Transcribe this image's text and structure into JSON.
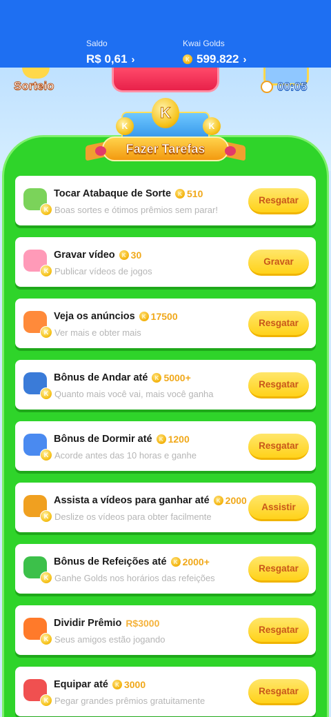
{
  "header": {
    "saldo_label": "Saldo",
    "saldo_value": "R$ 0,61",
    "golds_label": "Kwai Golds",
    "golds_value": "599.822",
    "chevron": "›"
  },
  "scene": {
    "sorteio_label": "Sorteio",
    "timer": "00:05"
  },
  "banner": {
    "title": "Fazer Tarefas",
    "coin_letter": "K"
  },
  "coin_letter": "K",
  "tasks": [
    {
      "title": "Tocar Atabaque de Sorte",
      "reward": "510",
      "desc": "Boas sortes e ótimos prêmios sem parar!",
      "button": "Resgatar",
      "icon": "drum-icon"
    },
    {
      "title": "Gravar vídeo",
      "reward": "30",
      "desc": "Publicar vídeos de jogos",
      "button": "Gravar",
      "icon": "camera-icon"
    },
    {
      "title": "Veja os anúncios",
      "reward": "17500",
      "desc": "Ver mais e obter mais",
      "button": "Resgatar",
      "icon": "tv-icon"
    },
    {
      "title": "Bônus de Andar até",
      "reward": "5000+",
      "desc": "Quanto mais você vai, mais você ganha",
      "button": "Resgatar",
      "icon": "walker-icon"
    },
    {
      "title": "Bônus de Dormir até",
      "reward": "1200",
      "desc": "Acorde antes das 10 horas e ganhe",
      "button": "Resgatar",
      "icon": "sleep-icon"
    },
    {
      "title": "Assista a vídeos para ganhar até",
      "reward": "2000",
      "desc": "Deslize os vídeos para obter facilmente",
      "button": "Assistir",
      "icon": "video-camera-icon"
    },
    {
      "title": "Bônus de Refeições até",
      "reward": "2000+",
      "desc": "Ganhe Golds nos horários das refeições",
      "button": "Resgatar",
      "icon": "calendar-icon"
    },
    {
      "title": "Dividir Prêmio",
      "reward": "R$3000",
      "desc": "Seus amigos estão jogando",
      "button": "Resgatar",
      "icon": "gift-icon"
    },
    {
      "title": "Equipar até",
      "reward": "3000",
      "desc": "Pegar grandes prêmios gratuitamente",
      "button": "Resgatar",
      "icon": "boxing-gloves-icon"
    }
  ]
}
